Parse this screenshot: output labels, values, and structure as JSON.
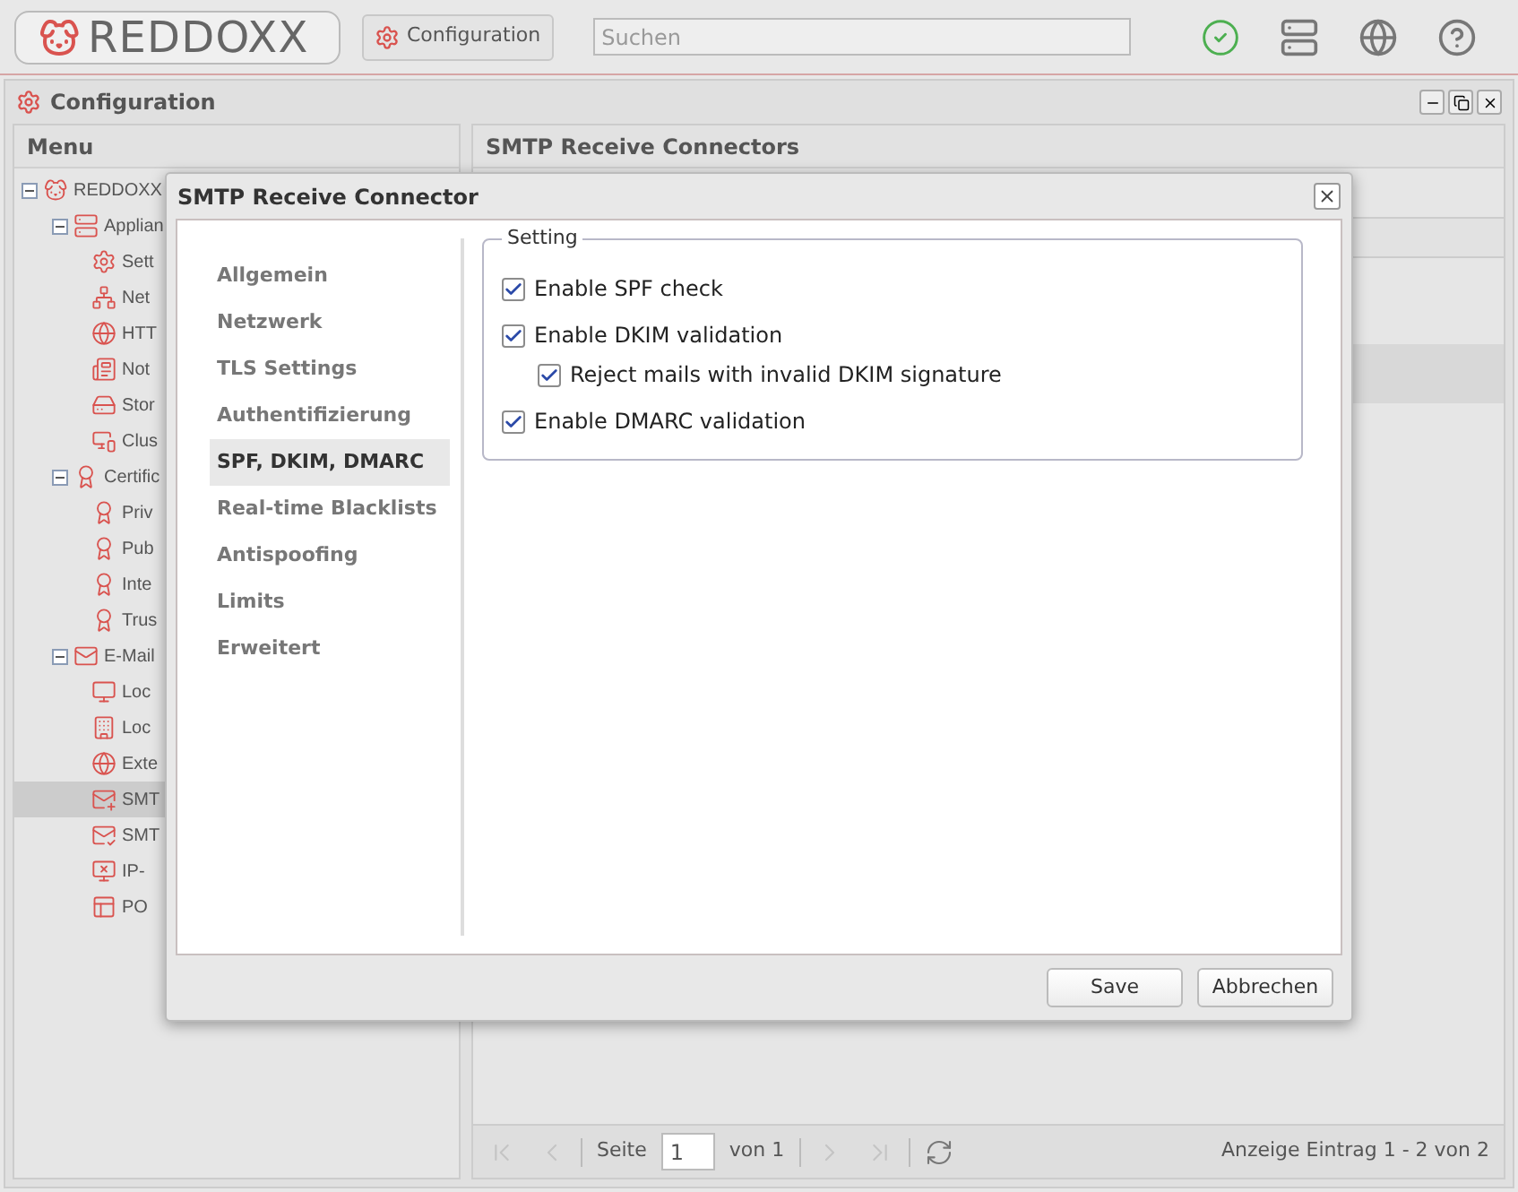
{
  "topbar": {
    "logo": "REDDOXX",
    "config_button": "Configuration",
    "search": {
      "placeholder": "Suchen"
    }
  },
  "window": {
    "title": "Configuration"
  },
  "menu": {
    "title": "Menu",
    "tree": [
      {
        "label": "REDDOXX",
        "expanded": true,
        "selected": false,
        "children": [
          {
            "label": "Applian",
            "expanded": true,
            "selected": false,
            "children": [
              {
                "label": "Sett",
                "selected": false
              },
              {
                "label": "Net",
                "selected": false
              },
              {
                "label": "HTT",
                "selected": false
              },
              {
                "label": "Not",
                "selected": false
              },
              {
                "label": "Stor",
                "selected": false
              },
              {
                "label": "Clus",
                "selected": false
              }
            ]
          },
          {
            "label": "Certific",
            "expanded": true,
            "selected": false,
            "children": [
              {
                "label": "Priv",
                "selected": false
              },
              {
                "label": "Pub",
                "selected": false
              },
              {
                "label": "Inte",
                "selected": false
              },
              {
                "label": "Trus",
                "selected": false
              }
            ]
          },
          {
            "label": "E-Mail",
            "expanded": true,
            "selected": false,
            "children": [
              {
                "label": "Loc",
                "selected": false
              },
              {
                "label": "Loc",
                "selected": false
              },
              {
                "label": "Exte",
                "selected": false
              },
              {
                "label": "SMT",
                "selected": true
              },
              {
                "label": "SMT",
                "selected": false
              },
              {
                "label": "IP-",
                "selected": false
              },
              {
                "label": "PO",
                "selected": false
              }
            ]
          }
        ]
      }
    ]
  },
  "main_panel": {
    "title": "SMTP Receive Connectors",
    "pager": {
      "page_label": "Seite",
      "page_value": "1",
      "page_total": "von 1",
      "summary": "Anzeige Eintrag 1 - 2 von 2",
      "buttons": [
        {
          "kind": "first",
          "disabled": true
        },
        {
          "kind": "prev",
          "disabled": true
        },
        {
          "kind": "next",
          "disabled": true
        },
        {
          "kind": "last",
          "disabled": true
        },
        {
          "kind": "refresh",
          "disabled": false
        }
      ]
    }
  },
  "dialog": {
    "title": "SMTP Receive Connector",
    "nav": [
      {
        "label": "Allgemein",
        "selected": false
      },
      {
        "label": "Netzwerk",
        "selected": false
      },
      {
        "label": "TLS Settings",
        "selected": false
      },
      {
        "label": "Authentifizierung",
        "selected": false
      },
      {
        "label": "SPF, DKIM, DMARC",
        "selected": true
      },
      {
        "label": "Real-time Blacklists",
        "selected": false
      },
      {
        "label": "Antispoofing",
        "selected": false
      },
      {
        "label": "Limits",
        "selected": false
      },
      {
        "label": "Erweitert",
        "selected": false
      }
    ],
    "fieldset": {
      "legend": "Setting",
      "options": [
        {
          "label": "Enable SPF check",
          "checked": true
        },
        {
          "label": "Enable DKIM validation",
          "checked": true,
          "children": [
            {
              "label": "Reject mails with invalid DKIM signature",
              "checked": true
            }
          ]
        },
        {
          "label": "Enable DMARC validation",
          "checked": true
        }
      ]
    },
    "buttons": [
      "Save",
      "Abbrechen"
    ]
  }
}
